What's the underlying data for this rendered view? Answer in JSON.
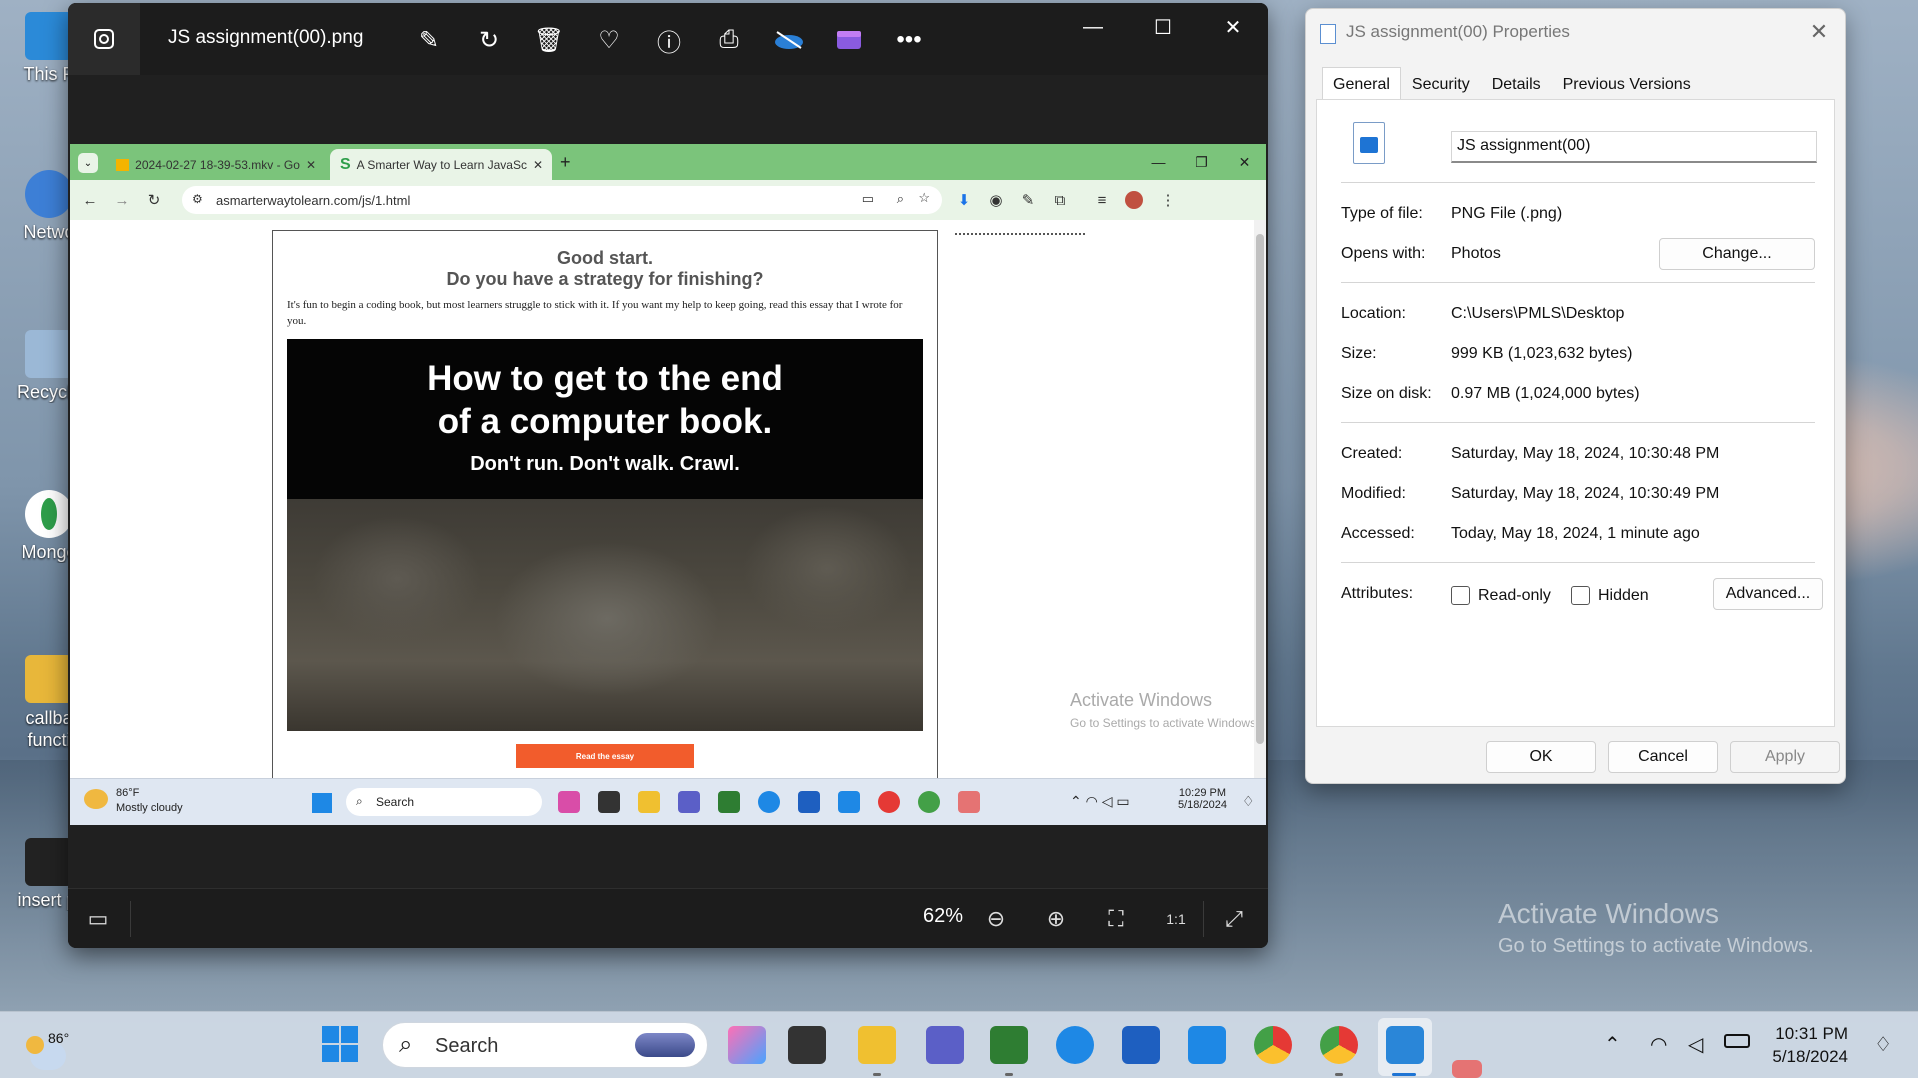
{
  "desktop": {
    "icons": [
      {
        "label": "This P",
        "color": "#2b8ad8"
      },
      {
        "label": "Netwo",
        "color": "#3d7fd6"
      },
      {
        "label": "Recycle",
        "color": "#9bb8d6"
      },
      {
        "label": "Mongo",
        "color": "#2e9e4a"
      },
      {
        "label": "callba\nfuncti",
        "color": "#e8b73a"
      },
      {
        "label": "insert pi",
        "color": "#222222"
      }
    ],
    "activate_title": "Activate Windows",
    "activate_sub": "Go to Settings to activate Windows."
  },
  "photos": {
    "title": "JS assignment(00).png",
    "tools": [
      "edit-icon",
      "rotate-icon",
      "delete-icon",
      "favorite-icon",
      "info-icon",
      "print-icon",
      "onedrive-icon",
      "clipchamp-icon",
      "more-icon"
    ],
    "zoom": "62%"
  },
  "screenshot": {
    "tabs": [
      {
        "label": "2024-02-27 18-39-53.mkv - Go"
      },
      {
        "label": "A Smarter Way to Learn JavaSc"
      }
    ],
    "url": "asmarterwaytolearn.com/js/1.html",
    "heading1": "Good start.",
    "heading2": "Do you have a strategy for finishing?",
    "paragraph": "It's fun to begin a coding book, but most learners struggle to stick with it. If you want my help to keep going, read this essay that I wrote for you.",
    "banner_line1": "How to get to the end",
    "banner_line2": "of a computer book.",
    "banner_line3": "Don't run. Don't walk. Crawl.",
    "read_button": "Read the essay",
    "activate_title": "Activate Windows",
    "activate_sub": "Go to Settings to activate Windows.",
    "taskbar": {
      "temp": "86°F",
      "weather": "Mostly cloudy",
      "search": "Search",
      "time": "10:29 PM",
      "date": "5/18/2024"
    }
  },
  "properties": {
    "title": "JS assignment(00) Properties",
    "tabs": [
      "General",
      "Security",
      "Details",
      "Previous Versions"
    ],
    "name": "JS assignment(00)",
    "type_label": "Type of file:",
    "type_value": "PNG File (.png)",
    "opens_label": "Opens with:",
    "opens_value": "Photos",
    "change_button": "Change...",
    "location_label": "Location:",
    "location_value": "C:\\Users\\PMLS\\Desktop",
    "size_label": "Size:",
    "size_value": "999 KB (1,023,632 bytes)",
    "disk_label": "Size on disk:",
    "disk_value": "0.97 MB (1,024,000 bytes)",
    "created_label": "Created:",
    "created_value": "Saturday, May 18, 2024, 10:30:48 PM",
    "modified_label": "Modified:",
    "modified_value": "Saturday, May 18, 2024, 10:30:49 PM",
    "accessed_label": "Accessed:",
    "accessed_value": "Today, May 18, 2024, 1 minute ago",
    "attributes_label": "Attributes:",
    "readonly_label": "Read-only",
    "hidden_label": "Hidden",
    "advanced_button": "Advanced...",
    "ok": "OK",
    "cancel": "Cancel",
    "apply": "Apply"
  },
  "taskbar": {
    "temp": "86°",
    "search": "Search",
    "time": "10:31 PM",
    "date": "5/18/2024"
  }
}
